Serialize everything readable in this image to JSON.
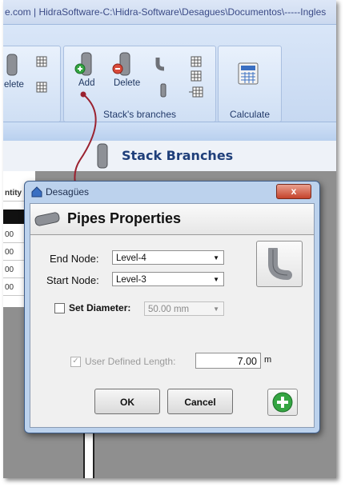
{
  "window": {
    "title": "e.com  |  HidraSoftware-C:\\Hidra-Software\\Desagues\\Documentos\\-----Ingles"
  },
  "ribbon": {
    "delete_partial_label": "elete",
    "stack_branches": {
      "label": "Stack's branches",
      "add_label": "Add",
      "delete_label": "Delete"
    },
    "calculate": {
      "label": "Calculate"
    }
  },
  "stack_branches_header": {
    "title": "Stack Branches"
  },
  "grid": {
    "header": "ntity",
    "cells": [
      "00",
      "00",
      "00",
      "00"
    ]
  },
  "dialog": {
    "title": "Desagües",
    "close_label": "x",
    "header_title": "Pipes Properties",
    "end_node": {
      "label": "End Node:",
      "value": "Level-4"
    },
    "start_node": {
      "label": "Start Node:",
      "value": "Level-3"
    },
    "set_diameter": {
      "label": "Set Diameter:",
      "value": "50.00 mm",
      "checked": false
    },
    "user_defined_length": {
      "label": "User Defined Length:",
      "value": "7.00",
      "unit": "m",
      "checked": true
    },
    "ok_label": "OK",
    "cancel_label": "Cancel"
  },
  "colors": {
    "ribbon": "#cfdef3",
    "dialog_frame": "#bcd2ed",
    "close_button": "#c5432b",
    "arrow": "#9b2230",
    "title_text": "#1f3f7a"
  }
}
